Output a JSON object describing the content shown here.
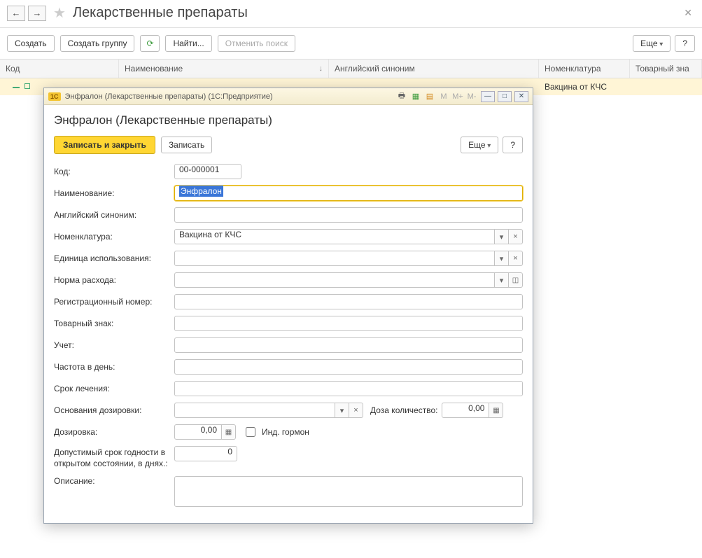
{
  "header": {
    "title": "Лекарственные препараты"
  },
  "toolbar": {
    "create": "Создать",
    "create_group": "Создать группу",
    "find": "Найти...",
    "cancel_search": "Отменить поиск",
    "more": "Еще",
    "help": "?"
  },
  "table": {
    "columns": {
      "code": "Код",
      "name": "Наименование",
      "en": "Английский синоним",
      "nom": "Номенклатура",
      "tm": "Товарный зна"
    },
    "row": {
      "nom": "Вакцина от КЧС"
    }
  },
  "popup": {
    "titlebar": "Энфралон (Лекарственные препараты)  (1С:Предприятие)",
    "title": "Энфралон (Лекарственные препараты)",
    "save_close": "Записать и закрыть",
    "save": "Записать",
    "more": "Еще",
    "help": "?",
    "labels": {
      "code": "Код:",
      "name": "Наименование:",
      "en": "Английский синоним:",
      "nom": "Номенклатура:",
      "unit": "Единица использования:",
      "rate": "Норма расхода:",
      "reg": "Регистрационный номер:",
      "tm": "Товарный знак:",
      "account": "Учет:",
      "freq": "Частота в день:",
      "duration": "Срок лечения:",
      "basis": "Основания дозировки:",
      "dose_qty": "Доза количество:",
      "dose": "Дозировка:",
      "ind_hormone": "Инд. гормон",
      "shelf": "Допустимый срок годности в открытом состоянии, в днях.:",
      "descr": "Описание:"
    },
    "values": {
      "code": "00-000001",
      "name": "Энфралон",
      "nom": "Вакцина от КЧС",
      "dose_qty": "0,00",
      "dose": "0,00",
      "shelf": "0"
    },
    "mbtns": {
      "m": "M",
      "mplus": "M+",
      "mminus": "M-"
    }
  }
}
